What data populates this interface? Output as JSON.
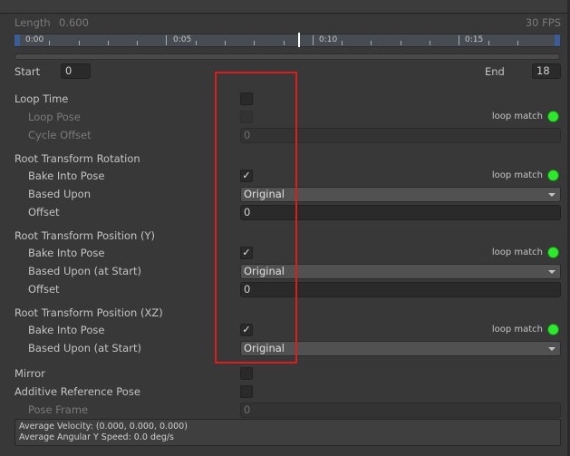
{
  "header": {
    "length_label": "Length",
    "length_value": "0.600",
    "fps": "30 FPS"
  },
  "timeline": {
    "ticks": [
      "0:00",
      "0:05",
      "0:10",
      "0:15"
    ],
    "playhead_frame": 9.5
  },
  "range": {
    "start_label": "Start",
    "start_value": "0",
    "end_label": "End",
    "end_value": "18"
  },
  "loop": {
    "loop_time": "Loop Time",
    "loop_time_checked": false,
    "loop_pose": "Loop Pose",
    "cycle_offset": "Cycle Offset",
    "cycle_offset_value": "0",
    "loop_match": "loop match"
  },
  "rotation": {
    "title": "Root Transform Rotation",
    "bake": "Bake Into Pose",
    "bake_checked": true,
    "based_upon": "Based Upon",
    "based_upon_value": "Original",
    "offset": "Offset",
    "offset_value": "0",
    "loop_match": "loop match"
  },
  "position_y": {
    "title": "Root Transform Position (Y)",
    "bake": "Bake Into Pose",
    "bake_checked": true,
    "based_upon": "Based Upon (at Start)",
    "based_upon_value": "Original",
    "offset": "Offset",
    "offset_value": "0",
    "loop_match": "loop match"
  },
  "position_xz": {
    "title": "Root Transform Position (XZ)",
    "bake": "Bake Into Pose",
    "bake_checked": true,
    "based_upon": "Based Upon (at Start)",
    "based_upon_value": "Original",
    "loop_match": "loop match"
  },
  "mirror": {
    "label": "Mirror",
    "checked": false
  },
  "additive": {
    "label": "Additive Reference Pose",
    "checked": false,
    "pose_frame": "Pose Frame",
    "pose_frame_value": "0"
  },
  "info": {
    "velocity": "Average Velocity: (0.000, 0.000, 0.000)",
    "angular": "Average Angular Y Speed: 0.0 deg/s"
  },
  "colors": {
    "loop_match_indicator": "#2ee82e",
    "highlight": "#e01b1b"
  },
  "check_glyph": "✓"
}
